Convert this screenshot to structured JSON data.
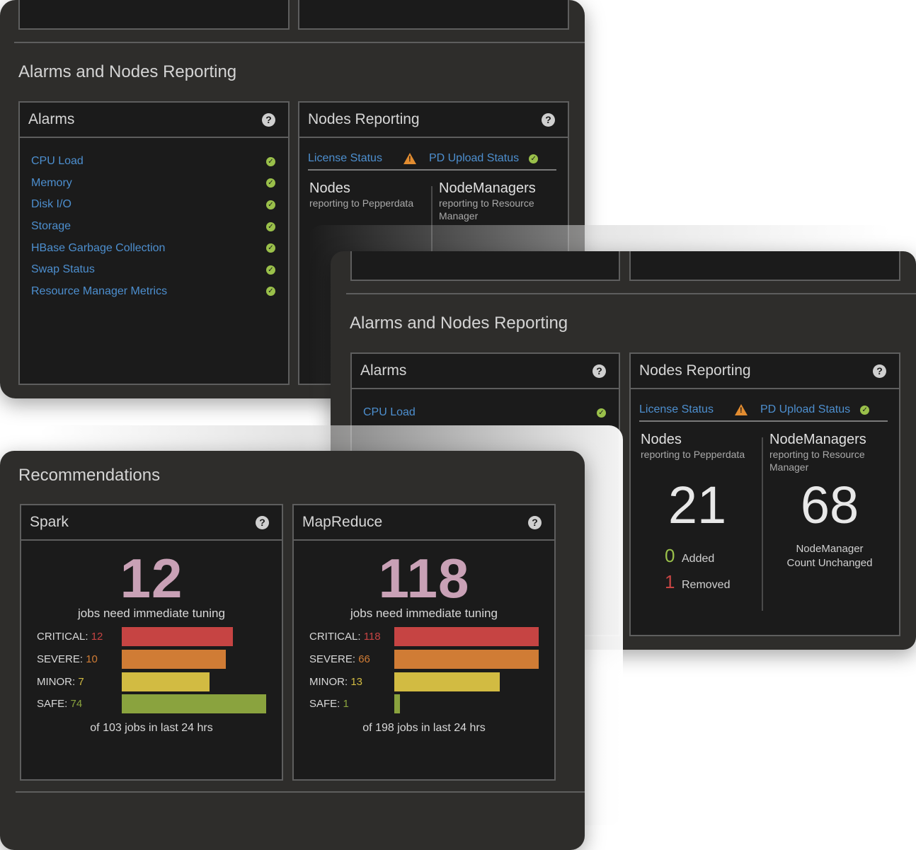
{
  "colors": {
    "critical": "#c64443",
    "severe": "#d07c35",
    "minor": "#d2bb42",
    "safe": "#8aa33e",
    "link": "#4d8fcf",
    "ok": "#9ac04a",
    "warn": "#e28c30"
  },
  "alarms_section": {
    "title": "Alarms and Nodes Reporting",
    "alarms_panel": {
      "title": "Alarms",
      "items": [
        {
          "label": "CPU Load",
          "status_icon": "check-circle-icon"
        },
        {
          "label": "Memory",
          "status_icon": "check-circle-icon"
        },
        {
          "label": "Disk I/O",
          "status_icon": "check-circle-icon"
        },
        {
          "label": "Storage",
          "status_icon": "check-circle-icon"
        },
        {
          "label": "HBase Garbage Collection",
          "status_icon": "check-circle-icon"
        },
        {
          "label": "Swap Status",
          "status_icon": "check-circle-icon"
        },
        {
          "label": "Resource Manager Metrics",
          "status_icon": "check-circle-icon"
        }
      ]
    },
    "nodes_panel": {
      "title": "Nodes Reporting",
      "license_status": "License Status",
      "pd_upload_status": "PD Upload Status",
      "nodes": {
        "title": "Nodes",
        "subtitle": "reporting to Pepperdata",
        "count": "21",
        "added_count": "0",
        "added_label": "Added",
        "removed_count": "1",
        "removed_label": "Removed"
      },
      "nodemanagers": {
        "title": "NodeManagers",
        "subtitle": "reporting to Resource Manager",
        "count": "68",
        "note": "NodeManager Count Unchanged"
      }
    }
  },
  "recommendations": {
    "title": "Recommendations",
    "spark": {
      "title": "Spark",
      "count": "12",
      "subtitle": "jobs need immediate tuning",
      "critical_label": "CRITICAL:",
      "critical": 12,
      "severe_label": "SEVERE:",
      "severe": 10,
      "minor_label": "MINOR:",
      "minor": 7,
      "safe_label": "SAFE:",
      "safe": 74,
      "bar_fractions": {
        "critical": 0.77,
        "severe": 0.72,
        "minor": 0.61,
        "safe": 1.0
      },
      "footer": "of 103 jobs in last 24 hrs"
    },
    "mapreduce": {
      "title": "MapReduce",
      "count": "118",
      "subtitle": "jobs need immediate tuning",
      "critical_label": "CRITICAL:",
      "critical": 118,
      "severe_label": "SEVERE:",
      "severe": 66,
      "minor_label": "MINOR:",
      "minor": 13,
      "safe_label": "SAFE:",
      "safe": 1,
      "bar_fractions": {
        "critical": 1.0,
        "severe": 1.0,
        "minor": 0.73,
        "safe": 0.04
      },
      "footer": "of 198 jobs in last 24 hrs"
    }
  }
}
